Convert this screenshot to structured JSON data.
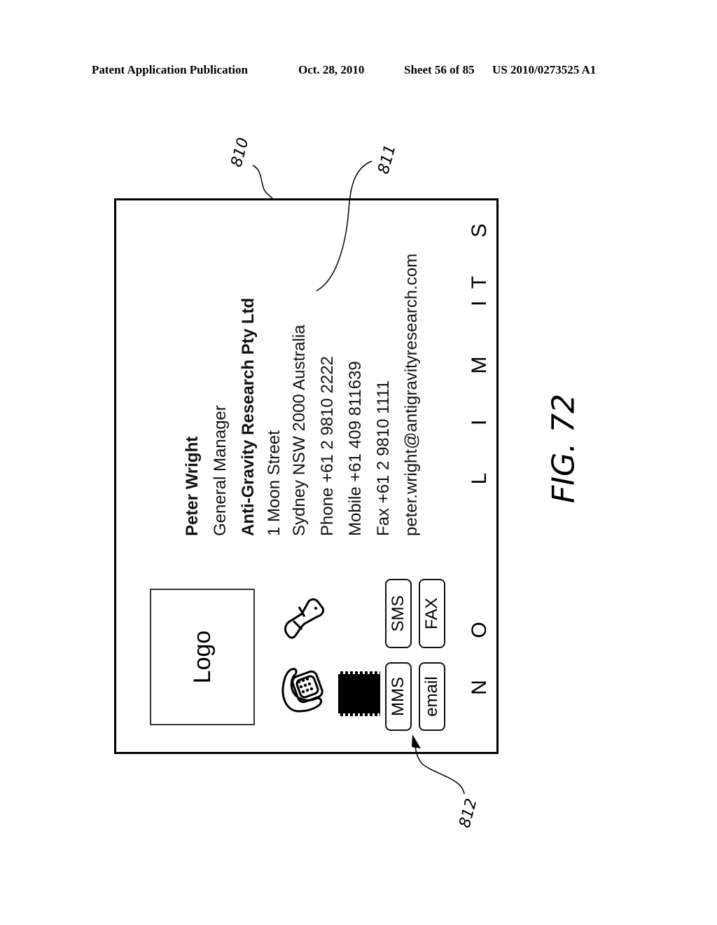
{
  "header": {
    "publication": "Patent Application Publication",
    "date": "Oct. 28, 2010",
    "sheet": "Sheet 56 of 85",
    "number": "US 2010/0273525 A1"
  },
  "figure": {
    "label": "FIG. 72",
    "refs": {
      "card": "810",
      "contact_info": "811",
      "buttons": "812"
    }
  },
  "card": {
    "logo_label": "Logo",
    "contact": {
      "name": "Peter Wright",
      "title": "General Manager",
      "company": "Anti-Gravity Research Pty Ltd",
      "address1": "1 Moon Street",
      "address2": "Sydney NSW 2000 Australia",
      "phone": "Phone +61 2 9810 2222",
      "mobile": "Mobile +61 409 811639",
      "fax": "Fax +61 2 9810 1111",
      "email": "peter.wright@antigravityresearch.com"
    },
    "icons": [
      "phone-icon",
      "mobile-phone-icon",
      "stamp-icon"
    ],
    "buttons": {
      "mms": "MMS",
      "sms": "SMS",
      "email": "email",
      "fax": "FAX"
    },
    "tagline_letters": [
      "N",
      "O",
      "L",
      "I",
      "M",
      "I",
      "T",
      "S"
    ]
  }
}
